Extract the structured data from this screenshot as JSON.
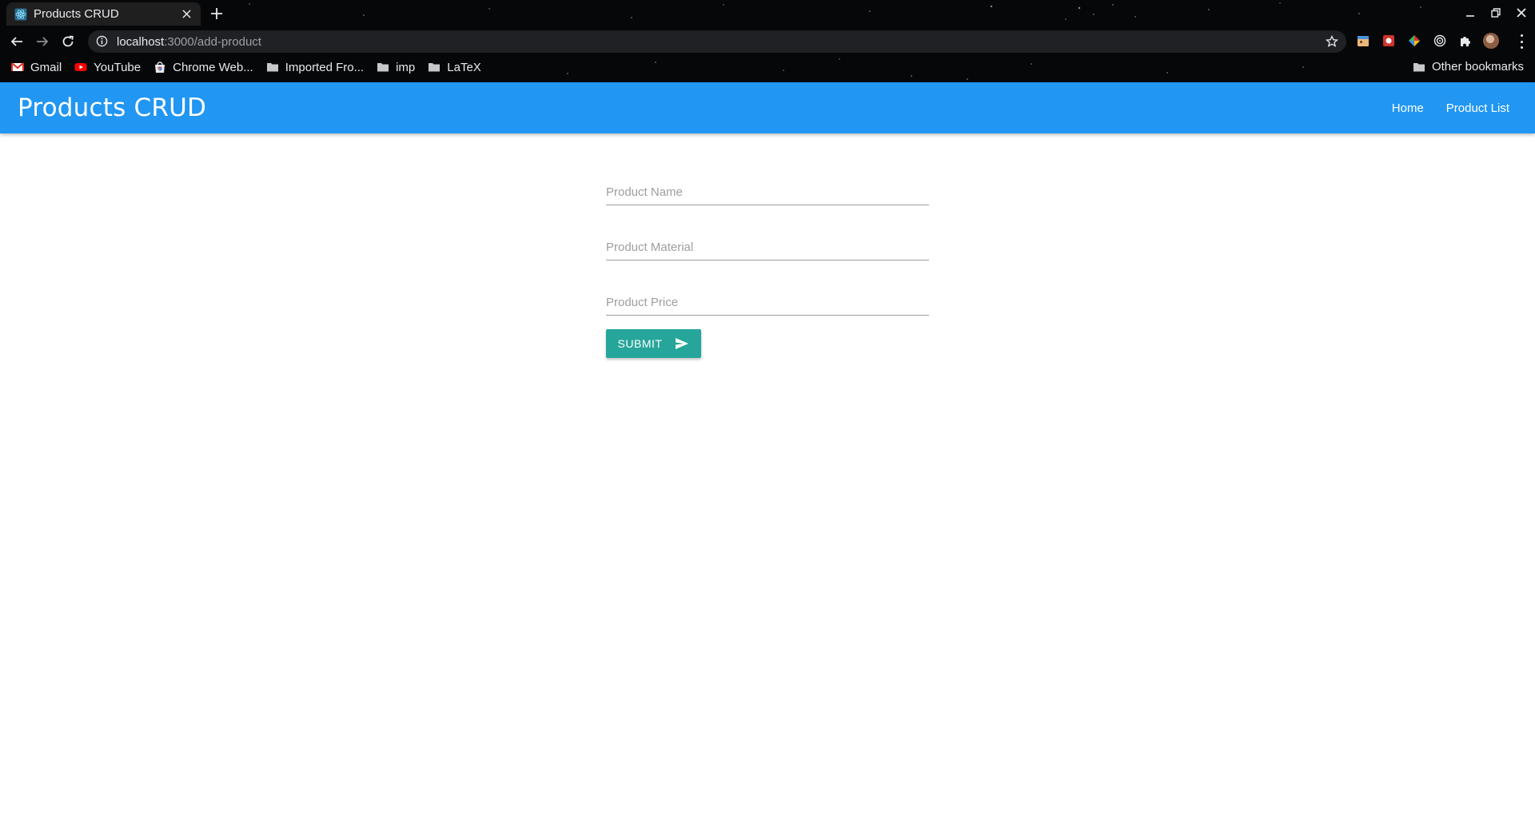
{
  "browser": {
    "tab_title": "Products CRUD",
    "url_host": "localhost",
    "url_path": ":3000/add-product",
    "bookmarks": [
      {
        "label": "Gmail",
        "icon": "gmail-icon"
      },
      {
        "label": "YouTube",
        "icon": "youtube-icon"
      },
      {
        "label": "Chrome Web...",
        "icon": "chrome-web-store-icon"
      },
      {
        "label": "Imported Fro...",
        "icon": "folder-icon"
      },
      {
        "label": "imp",
        "icon": "folder-icon"
      },
      {
        "label": "LaTeX",
        "icon": "folder-icon"
      }
    ],
    "other_bookmarks": "Other bookmarks"
  },
  "app": {
    "brand": "Products CRUD",
    "nav": [
      "Home",
      "Product List"
    ],
    "accent_color": "#2196f3"
  },
  "form": {
    "name_placeholder": "Product Name",
    "material_placeholder": "Product Material",
    "price_placeholder": "Product Price",
    "submit_label": "SUBMIT",
    "submit_color": "#26a69a"
  }
}
